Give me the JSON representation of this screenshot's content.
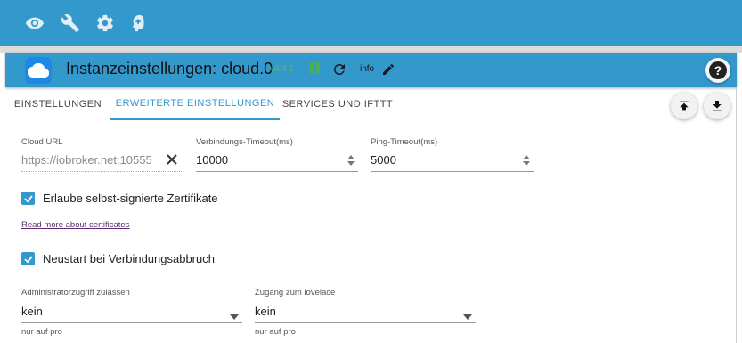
{
  "toolbar": {
    "icons": [
      "eye-icon",
      "wrench-icon",
      "gear-icon",
      "head-icon"
    ]
  },
  "instance": {
    "title": "Instanzeinstellungen: cloud.0",
    "version": "v4.4.1",
    "info_label": "info",
    "help_symbol": "?"
  },
  "tabs": [
    {
      "label": "EINSTELLUNGEN",
      "active": false
    },
    {
      "label": "ERWEITERTE EINSTELLUNGEN",
      "active": true
    },
    {
      "label": "SERVICES UND IFTTT",
      "active": false
    }
  ],
  "form": {
    "cloud_url": {
      "label": "Cloud URL",
      "value": "https://iobroker.net:10555"
    },
    "connect_timeout": {
      "label": "Verbindungs-Timeout(ms)",
      "value": "10000"
    },
    "ping_timeout": {
      "label": "Ping-Timeout(ms)",
      "value": "5000"
    },
    "self_signed": {
      "label": "Erlaube selbst-signierte Zertifikate",
      "checked": true
    },
    "cert_link": "Read more about certificates",
    "restart": {
      "label": "Neustart bei Verbindungsabbruch",
      "checked": true
    },
    "admin_access": {
      "label": "Administratorzugriff zulassen",
      "value": "kein",
      "helper": "nur auf pro"
    },
    "lovelace_access": {
      "label": "Zugang zum lovelace",
      "value": "kein",
      "helper": "nur auf pro"
    }
  },
  "colors": {
    "accent": "#3399cc",
    "version": "#6ab04c",
    "pause": "#4caf50",
    "link": "#5b2c6f"
  }
}
